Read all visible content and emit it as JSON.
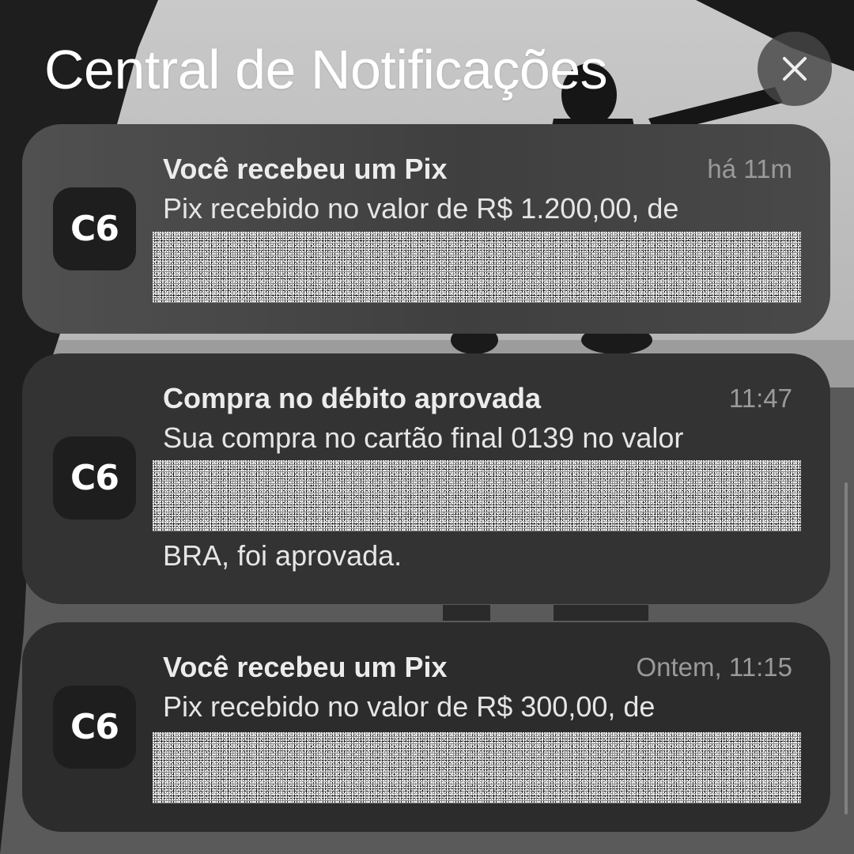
{
  "header": {
    "title": "Central de Notificações"
  },
  "close": {
    "icon": "close-icon"
  },
  "notifications": [
    {
      "app_icon": "C6",
      "title": "Você recebeu um Pix",
      "time": "há 11m",
      "body": "Pix recebido no valor de R$ 1.200,00, de",
      "body_end": ""
    },
    {
      "app_icon": "C6",
      "title": "Compra no débito aprovada",
      "time": "11:47",
      "body": "Sua compra no cartão final 0139 no valor",
      "body_end": "BRA, foi aprovada."
    },
    {
      "app_icon": "C6",
      "title": "Você recebeu um Pix",
      "time": "Ontem, 11:15",
      "body": "Pix recebido no valor de R$ 300,00, de",
      "body_end": ""
    }
  ]
}
